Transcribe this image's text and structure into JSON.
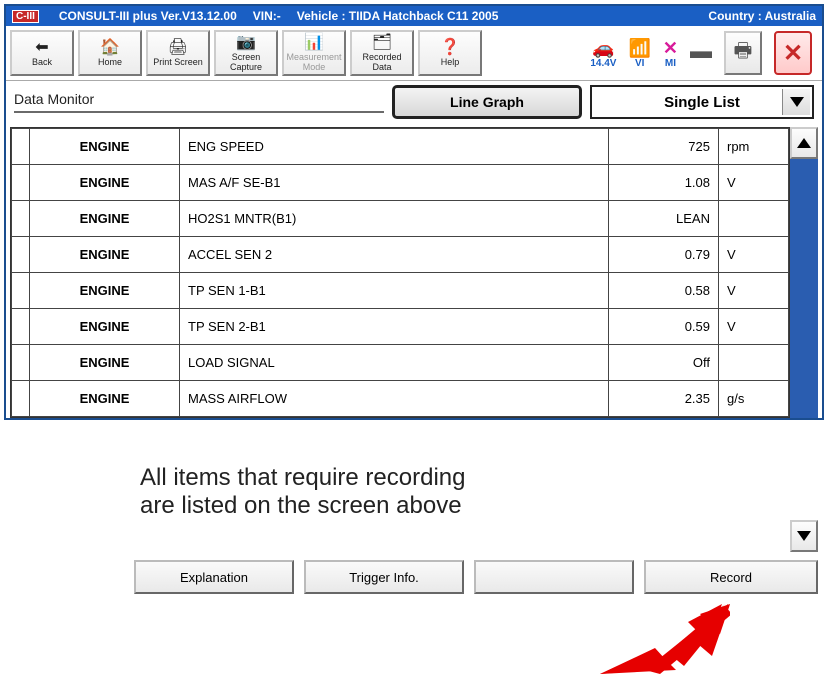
{
  "titlebar": {
    "badge": "C-III",
    "app": "CONSULT-III plus  Ver.V13.12.00",
    "vin": "VIN:-",
    "vehicle": "Vehicle : TIIDA Hatchback C11 2005",
    "country": "Country : Australia"
  },
  "toolbar": {
    "back": "Back",
    "home": "Home",
    "print": "Print Screen",
    "capture": "Screen Capture",
    "measure": "Measurement Mode",
    "recorded": "Recorded Data",
    "help": "Help"
  },
  "status": {
    "voltage": "14.4V",
    "signal": "VI",
    "mi": "MI"
  },
  "subheader": {
    "title": "Data Monitor",
    "mode_btn": "Line Graph",
    "dropdown": "Single List"
  },
  "table": {
    "rows": [
      {
        "sys": "ENGINE",
        "param": "ENG SPEED",
        "val": "725",
        "unit": "rpm"
      },
      {
        "sys": "ENGINE",
        "param": "MAS A/F SE-B1",
        "val": "1.08",
        "unit": "V"
      },
      {
        "sys": "ENGINE",
        "param": "HO2S1 MNTR(B1)",
        "val": "LEAN",
        "unit": ""
      },
      {
        "sys": "ENGINE",
        "param": "ACCEL SEN 2",
        "val": "0.79",
        "unit": "V"
      },
      {
        "sys": "ENGINE",
        "param": "TP SEN 1-B1",
        "val": "0.58",
        "unit": "V"
      },
      {
        "sys": "ENGINE",
        "param": "TP SEN 2-B1",
        "val": "0.59",
        "unit": "V"
      },
      {
        "sys": "ENGINE",
        "param": "LOAD SIGNAL",
        "val": "Off",
        "unit": ""
      },
      {
        "sys": "ENGINE",
        "param": "MASS AIRFLOW",
        "val": "2.35",
        "unit": "g/s"
      }
    ]
  },
  "annotation": {
    "line1": "All items that require recording",
    "line2": "are listed on the screen above"
  },
  "footer": {
    "explanation": "Explanation",
    "trigger": "Trigger Info.",
    "record": "Record"
  }
}
